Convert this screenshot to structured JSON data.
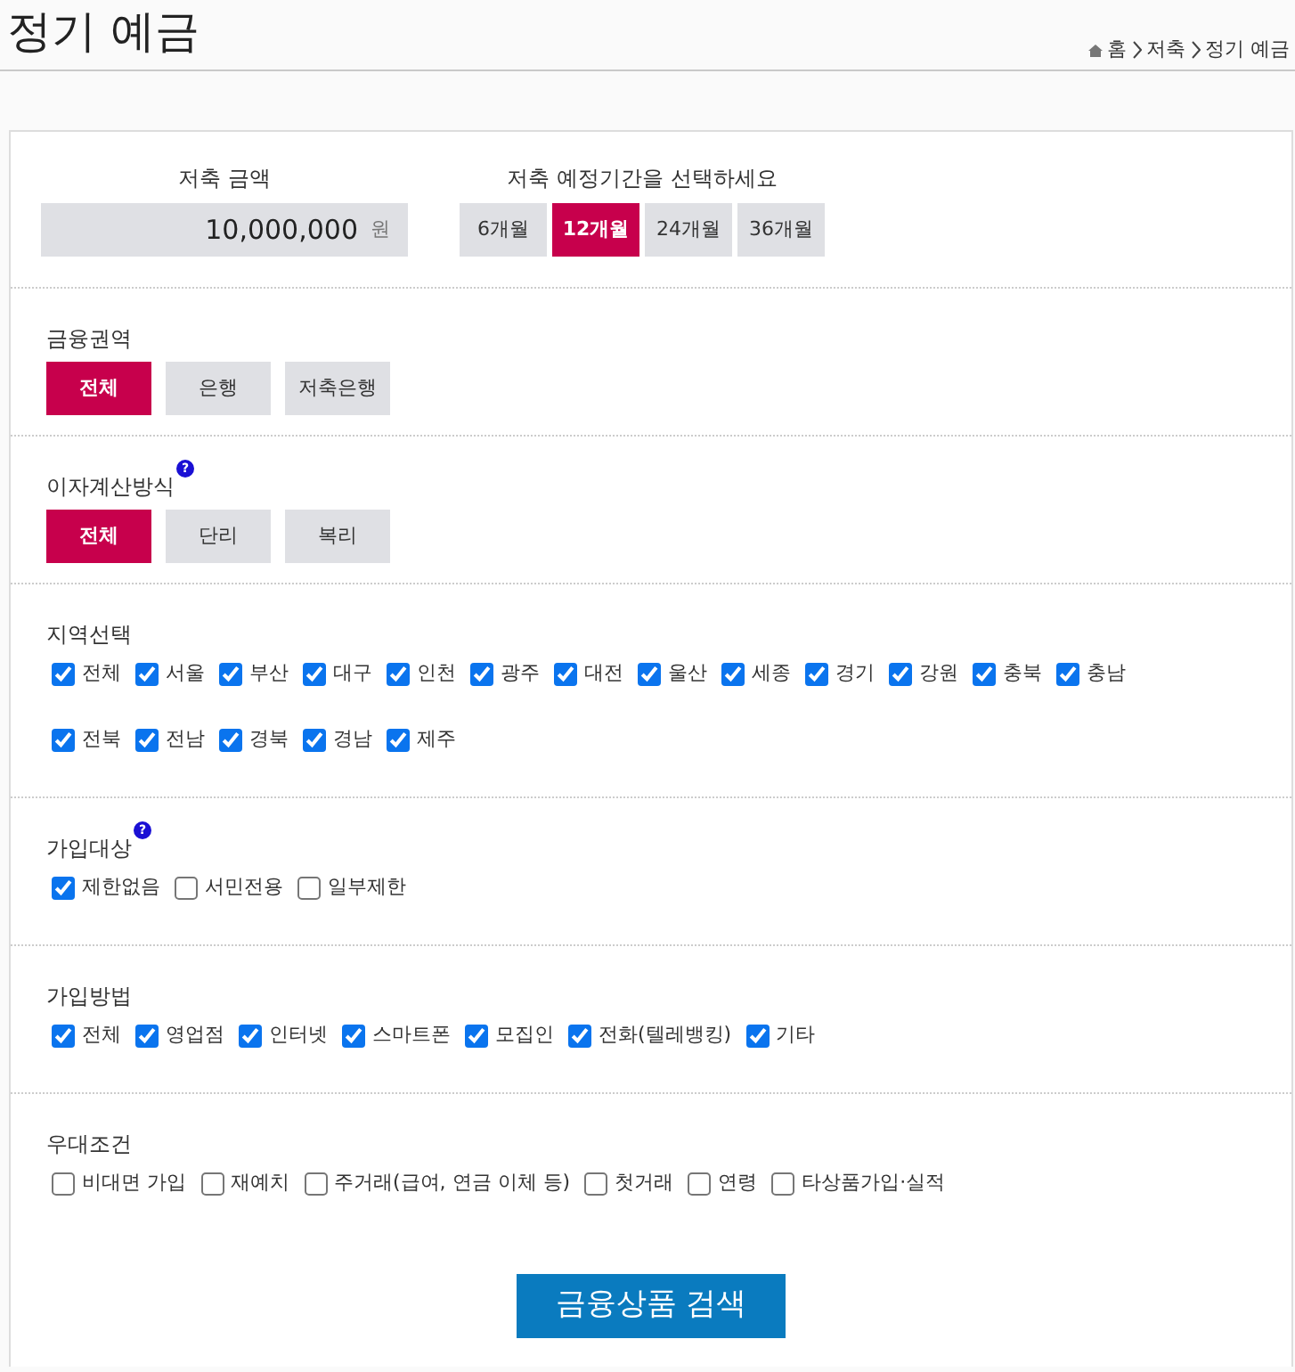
{
  "page": {
    "title": "정기 예금"
  },
  "breadcrumb": [
    "홈",
    "저축",
    "정기 예금"
  ],
  "amount": {
    "label": "저축 금액",
    "value": "10,000,000",
    "unit": "원"
  },
  "period": {
    "label": "저축 예정기간을 선택하세요",
    "options": [
      {
        "label": "6개월",
        "selected": false
      },
      {
        "label": "12개월",
        "selected": true
      },
      {
        "label": "24개월",
        "selected": false
      },
      {
        "label": "36개월",
        "selected": false
      }
    ]
  },
  "sections": [
    {
      "kind": "buttons",
      "title": "금융권역",
      "options": [
        {
          "label": "전체",
          "selected": true
        },
        {
          "label": "은행",
          "selected": false
        },
        {
          "label": "저축은행",
          "selected": false
        }
      ]
    },
    {
      "kind": "buttons",
      "title": "이자계산방식",
      "help": "?",
      "options": [
        {
          "label": "전체",
          "selected": true
        },
        {
          "label": "단리",
          "selected": false
        },
        {
          "label": "복리",
          "selected": false
        }
      ]
    },
    {
      "kind": "checkboxes",
      "title": "지역선택",
      "rows": [
        [
          {
            "label": "전체",
            "checked": true
          },
          {
            "label": "서울",
            "checked": true
          },
          {
            "label": "부산",
            "checked": true
          },
          {
            "label": "대구",
            "checked": true
          },
          {
            "label": "인천",
            "checked": true
          },
          {
            "label": "광주",
            "checked": true
          },
          {
            "label": "대전",
            "checked": true
          },
          {
            "label": "울산",
            "checked": true
          },
          {
            "label": "세종",
            "checked": true
          },
          {
            "label": "경기",
            "checked": true
          },
          {
            "label": "강원",
            "checked": true
          },
          {
            "label": "충북",
            "checked": true
          },
          {
            "label": "충남",
            "checked": true
          }
        ],
        [
          {
            "label": "전북",
            "checked": true
          },
          {
            "label": "전남",
            "checked": true
          },
          {
            "label": "경북",
            "checked": true
          },
          {
            "label": "경남",
            "checked": true
          },
          {
            "label": "제주",
            "checked": true
          }
        ]
      ]
    },
    {
      "kind": "checkboxes",
      "title": "가입대상",
      "help": "?",
      "rows": [
        [
          {
            "label": "제한없음",
            "checked": true
          },
          {
            "label": "서민전용",
            "checked": false
          },
          {
            "label": "일부제한",
            "checked": false
          }
        ]
      ]
    },
    {
      "kind": "checkboxes",
      "title": "가입방법",
      "rows": [
        [
          {
            "label": "전체",
            "checked": true
          },
          {
            "label": "영업점",
            "checked": true
          },
          {
            "label": "인터넷",
            "checked": true
          },
          {
            "label": "스마트폰",
            "checked": true
          },
          {
            "label": "모집인",
            "checked": true
          },
          {
            "label": "전화(텔레뱅킹)",
            "checked": true
          },
          {
            "label": "기타",
            "checked": true
          }
        ]
      ]
    },
    {
      "kind": "checkboxes",
      "title": "우대조건",
      "rows": [
        [
          {
            "label": "비대면 가입",
            "checked": false
          },
          {
            "label": "재예치",
            "checked": false
          },
          {
            "label": "주거래(급여, 연금 이체 등)",
            "checked": false
          },
          {
            "label": "첫거래",
            "checked": false
          },
          {
            "label": "연령",
            "checked": false
          },
          {
            "label": "타상품가입·실적",
            "checked": false
          }
        ]
      ]
    }
  ],
  "search_button": "금융상품 검색"
}
